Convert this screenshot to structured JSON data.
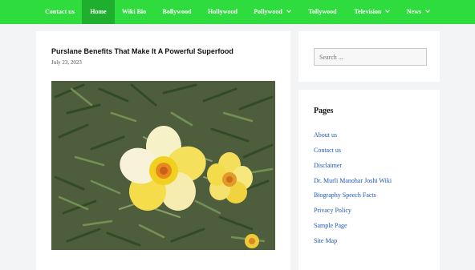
{
  "nav": {
    "items": [
      {
        "label": "Contact us",
        "active": false,
        "dropdown": false
      },
      {
        "label": "Home",
        "active": true,
        "dropdown": false
      },
      {
        "label": "Wiki Bio",
        "active": false,
        "dropdown": false
      },
      {
        "label": "Bollywood",
        "active": false,
        "dropdown": false
      },
      {
        "label": "Hollywood",
        "active": false,
        "dropdown": false
      },
      {
        "label": "Pollywood",
        "active": false,
        "dropdown": true
      },
      {
        "label": "Tollywood",
        "active": false,
        "dropdown": false
      },
      {
        "label": "Television",
        "active": false,
        "dropdown": true
      },
      {
        "label": "News",
        "active": false,
        "dropdown": true
      }
    ],
    "colors": {
      "bar": "#2fdc3e",
      "active": "#1fae2d",
      "text": "#ffffff"
    }
  },
  "post": {
    "title": "Purslane Benefits That Make It A Powerful Superfood",
    "date": "July 23, 2023"
  },
  "sidebar": {
    "search": {
      "placeholder": "Search ..."
    },
    "pages": {
      "title": "Pages",
      "links": [
        "About us",
        "Contact us",
        "Disclaimer",
        "Dr. Murli Manohar Joshi Wiki",
        "Biography Speech Facts",
        "Privacy Policy",
        "Sample Page",
        "Site Map"
      ]
    },
    "link_color": "#1e57b8"
  }
}
